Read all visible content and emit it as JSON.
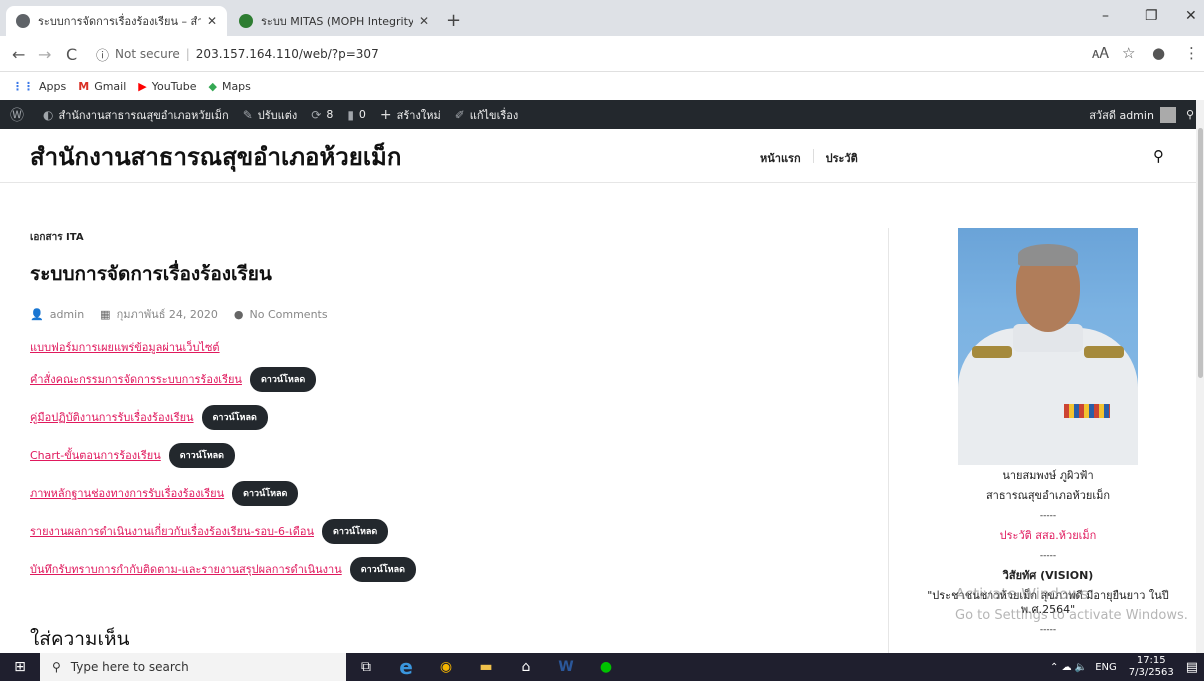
{
  "browser": {
    "tabs": [
      {
        "title": "ระบบการจัดการเรื่องร้องเรียน – สำนักง",
        "active": true
      },
      {
        "title": "ระบบ MITAS (MOPH Integrity and",
        "active": false
      }
    ],
    "new_tab": "+",
    "close_glyph": "✕",
    "window_controls": {
      "minimize": "–",
      "maximize": "❐",
      "close": "✕"
    },
    "address": {
      "not_secure": "Not secure",
      "url": "203.157.164.110/web/?p=307"
    },
    "nav_icons": {
      "back": "←",
      "forward": "→",
      "reload": "C"
    },
    "toolbar_icons": {
      "translate": "🗚",
      "star": "☆",
      "profile": "●",
      "menu": "⋮"
    },
    "bookmarks": [
      {
        "label": "Apps",
        "icon": "apps-icon",
        "glyph": "⋮⋮",
        "color": "#3b78e7"
      },
      {
        "label": "Gmail",
        "icon": "gmail-icon",
        "glyph": "M",
        "color": "#d93025"
      },
      {
        "label": "YouTube",
        "icon": "youtube-icon",
        "glyph": "▶",
        "color": "#ff0000"
      },
      {
        "label": "Maps",
        "icon": "maps-icon",
        "glyph": "◆",
        "color": "#34a853"
      }
    ]
  },
  "adminbar": {
    "wp_icon": "Ⓦ",
    "site": "สำนักงานสาธารณสุขอำเภอหวัยเม็ก",
    "customize": "ปรับแต่ง",
    "updates": "8",
    "comments": "0",
    "new": "สร้างใหม่",
    "edit": "แก้ไขเรื่อง",
    "greeting": "สวัสดี admin",
    "search_glyph": "⚲"
  },
  "site": {
    "title": "สำนักงานสาธารณสุขอำเภอห้วยเม็ก",
    "nav": [
      "หน้าแรก",
      "ประวัติ"
    ],
    "search_glyph": "⚲"
  },
  "post": {
    "category": "เอกสาร ITA",
    "title": "ระบบการจัดการเรื่องร้องเรียน",
    "author": "admin",
    "date": "กุมภาพันธ์ 24, 2020",
    "comments": "No Comments",
    "intro_link": "แบบฟอร์มการเผยแพร่ข้อมูลผ่านเว็บไซต์",
    "download_label": "ดาวน์โหลด",
    "documents": [
      "คำสั่งคณะกรรมการจัดการระบบการร้องเรียน",
      "คู่มือปฏิบัติงานการรับเรื่องร้องเรียน",
      "Chart-ขั้นตอนการร้องเรียน",
      "ภาพหลักฐานช่องทางการรับเรื่องร้องเรียน",
      "รายงานผลการดำเนินงานเกี่ยวกับเรื่องร้องเรียน-รอบ-6-เดือน",
      "บันทึกรับทราบการกำกับติดตาม-และรายงานสรุปผลการดำเนินงาน"
    ],
    "comment_heading": "ใส่ความเห็น"
  },
  "sidebar": {
    "name": "นายสมพงษ์ ภูผิวฟ้า",
    "position": "สาธารณสุขอำเภอห้วยเม็ก",
    "divider": "-----",
    "history_link": "ประวัติ สสอ.ห้วยเม็ก",
    "vision_title": "วิสัยทัศ (VISION)",
    "vision_text": "\"ประชาชนชาวห้วยเม็ก สุขภาพดี มีอายุยืนยาว ในปี พ.ศ.2564\""
  },
  "watermark": {
    "line1": "Activate Windows",
    "line2": "Go to Settings to activate Windows."
  },
  "taskbar": {
    "search_placeholder": "Type here to search",
    "start_glyph": "⊞",
    "search_glyph": "⚲",
    "apps": [
      {
        "name": "task-view-icon",
        "glyph": "⧉",
        "color": "#ffffff"
      },
      {
        "name": "edge-icon",
        "glyph": "e",
        "color": "#3a96dd"
      },
      {
        "name": "chrome-icon",
        "glyph": "◉",
        "color": "#f4b400"
      },
      {
        "name": "file-explorer-icon",
        "glyph": "▬",
        "color": "#f0c14b"
      },
      {
        "name": "store-icon",
        "glyph": "⌂",
        "color": "#ffffff"
      },
      {
        "name": "word-icon",
        "glyph": "W",
        "color": "#2b579a"
      },
      {
        "name": "line-icon",
        "glyph": "●",
        "color": "#00c300"
      }
    ],
    "tray": {
      "lang": "ENG",
      "time": "17:15",
      "date": "7/3/2563",
      "glyphs": "⌃ ☁ 🔈"
    }
  }
}
